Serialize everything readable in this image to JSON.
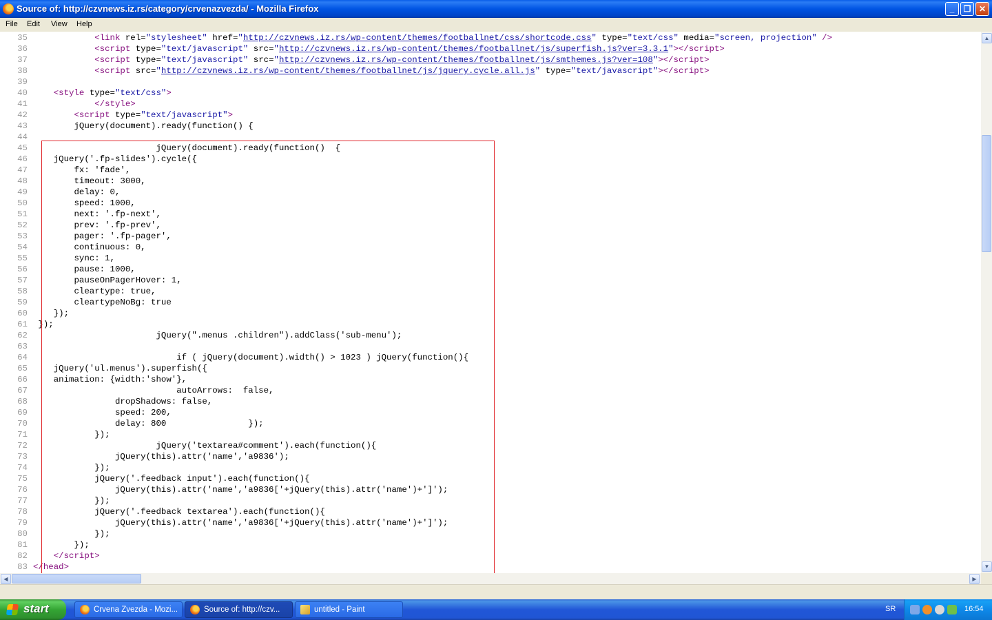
{
  "window": {
    "title": "Source of: http://czvnews.iz.rs/category/crvenazvezda/ - Mozilla Firefox",
    "minimize": "_",
    "maximize": "❐",
    "close": "✕"
  },
  "menu": {
    "file": "File",
    "edit": "Edit",
    "view": "View",
    "help": "Help"
  },
  "lines": [
    {
      "n": "35",
      "html": "            <span class=\"t\">&lt;link</span> <span class=\"a\">rel=</span><span class=\"v\">\"stylesheet\"</span> <span class=\"a\">href=</span><span class=\"v\">\"</span><span class=\"u\">http://czvnews.iz.rs/wp-content/themes/footballnet/css/shortcode.css</span><span class=\"v\">\"</span> <span class=\"a\">type=</span><span class=\"v\">\"text/css\"</span> <span class=\"a\">media=</span><span class=\"v\">\"screen, projection\"</span> <span class=\"t\">/&gt;</span>"
    },
    {
      "n": "36",
      "html": "            <span class=\"t\">&lt;script</span> <span class=\"a\">type=</span><span class=\"v\">\"text/javascript\"</span> <span class=\"a\">src=</span><span class=\"v\">\"</span><span class=\"u\">http://czvnews.iz.rs/wp-content/themes/footballnet/js/superfish.js?ver=3.3.1</span><span class=\"v\">\"</span><span class=\"t\">&gt;&lt;/script&gt;</span>"
    },
    {
      "n": "37",
      "html": "            <span class=\"t\">&lt;script</span> <span class=\"a\">type=</span><span class=\"v\">\"text/javascript\"</span> <span class=\"a\">src=</span><span class=\"v\">\"</span><span class=\"u\">http://czvnews.iz.rs/wp-content/themes/footballnet/js/smthemes.js?ver=108</span><span class=\"v\">\"</span><span class=\"t\">&gt;&lt;/script&gt;</span>"
    },
    {
      "n": "38",
      "html": "            <span class=\"t\">&lt;script</span> <span class=\"a\">src=</span><span class=\"v\">\"</span><span class=\"u\">http://czvnews.iz.rs/wp-content/themes/footballnet/js/jquery.cycle.all.js</span><span class=\"v\">\"</span> <span class=\"a\">type=</span><span class=\"v\">\"text/javascript\"</span><span class=\"t\">&gt;&lt;/script&gt;</span>"
    },
    {
      "n": "39",
      "html": ""
    },
    {
      "n": "40",
      "html": "    <span class=\"t\">&lt;style</span> <span class=\"a\">type=</span><span class=\"v\">\"text/css\"</span><span class=\"t\">&gt;</span>"
    },
    {
      "n": "41",
      "html": "            <span class=\"t\">&lt;/style&gt;</span>"
    },
    {
      "n": "42",
      "html": "        <span class=\"t\">&lt;script</span> <span class=\"a\">type=</span><span class=\"v\">\"text/javascript\"</span><span class=\"t\">&gt;</span>"
    },
    {
      "n": "43",
      "html": "        jQuery(document).ready(function() {"
    },
    {
      "n": "44",
      "html": ""
    },
    {
      "n": "45",
      "html": "                        jQuery(document).ready(function()  {"
    },
    {
      "n": "46",
      "html": "    jQuery('.fp-slides').cycle({"
    },
    {
      "n": "47",
      "html": "        fx: 'fade',"
    },
    {
      "n": "48",
      "html": "        timeout: 3000,"
    },
    {
      "n": "49",
      "html": "        delay: 0,"
    },
    {
      "n": "50",
      "html": "        speed: 1000,"
    },
    {
      "n": "51",
      "html": "        next: '.fp-next',"
    },
    {
      "n": "52",
      "html": "        prev: '.fp-prev',"
    },
    {
      "n": "53",
      "html": "        pager: '.fp-pager',"
    },
    {
      "n": "54",
      "html": "        continuous: 0,"
    },
    {
      "n": "55",
      "html": "        sync: 1,"
    },
    {
      "n": "56",
      "html": "        pause: 1000,"
    },
    {
      "n": "57",
      "html": "        pauseOnPagerHover: 1,"
    },
    {
      "n": "58",
      "html": "        cleartype: true,"
    },
    {
      "n": "59",
      "html": "        cleartypeNoBg: true"
    },
    {
      "n": "60",
      "html": "    });"
    },
    {
      "n": "61",
      "html": " });"
    },
    {
      "n": "62",
      "html": "                        jQuery(\".menus .children\").addClass('sub-menu');"
    },
    {
      "n": "63",
      "html": ""
    },
    {
      "n": "64",
      "html": "                            if ( jQuery(document).width() > 1023 ) jQuery(function(){"
    },
    {
      "n": "65",
      "html": "    jQuery('ul.menus').superfish({"
    },
    {
      "n": "66",
      "html": "    animation: {width:'show'},"
    },
    {
      "n": "67",
      "html": "                            autoArrows:  false,"
    },
    {
      "n": "68",
      "html": "                dropShadows: false,"
    },
    {
      "n": "69",
      "html": "                speed: 200,"
    },
    {
      "n": "70",
      "html": "                delay: 800                });"
    },
    {
      "n": "71",
      "html": "            });"
    },
    {
      "n": "72",
      "html": "                        jQuery('textarea#comment').each(function(){"
    },
    {
      "n": "73",
      "html": "                jQuery(this).attr('name','a9836');"
    },
    {
      "n": "74",
      "html": "            });"
    },
    {
      "n": "75",
      "html": "            jQuery('.feedback input').each(function(){"
    },
    {
      "n": "76",
      "html": "                jQuery(this).attr('name','a9836['+jQuery(this).attr('name')+']');"
    },
    {
      "n": "77",
      "html": "            });"
    },
    {
      "n": "78",
      "html": "            jQuery('.feedback textarea').each(function(){"
    },
    {
      "n": "79",
      "html": "                jQuery(this).attr('name','a9836['+jQuery(this).attr('name')+']');"
    },
    {
      "n": "80",
      "html": "            });"
    },
    {
      "n": "81",
      "html": "        });"
    },
    {
      "n": "82",
      "html": "    <span class=\"t\">&lt;/script&gt;</span>"
    },
    {
      "n": "83",
      "html": "<span class=\"t\">&lt;/head&gt;</span>"
    }
  ],
  "taskbar": {
    "start": "start",
    "tasks": [
      {
        "label": "Crvena Zvezda - Mozi...",
        "icon": "firefox-icon"
      },
      {
        "label": "Source of: http://czv...",
        "icon": "firefox-icon"
      },
      {
        "label": "untitled - Paint",
        "icon": "paint-icon"
      }
    ],
    "language": "SR",
    "clock": "16:54"
  },
  "colors": {
    "titlebar": "#0054e3",
    "highlight_box": "#e0262b",
    "tag": "#881280",
    "value": "#1a1aa6"
  }
}
